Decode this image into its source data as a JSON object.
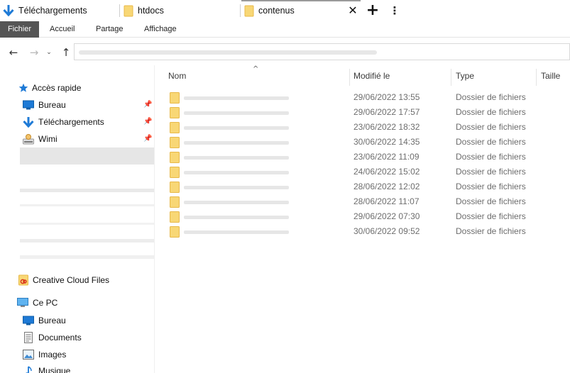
{
  "tabs": [
    {
      "label": "Téléchargements",
      "icon": "download-arrow-icon"
    },
    {
      "label": "htdocs",
      "icon": "folder-icon"
    },
    {
      "label": "contenus",
      "icon": "folder-icon",
      "active": true
    }
  ],
  "tab_controls": {
    "close": "✕",
    "add": "+",
    "menu": "⋮"
  },
  "ribbon": {
    "file_label": "Fichier",
    "tabs": [
      "Accueil",
      "Partage",
      "Affichage"
    ]
  },
  "nav": {
    "back": "←",
    "forward": "→",
    "dropdown": "⌄",
    "up": "↑"
  },
  "sidebar": {
    "quick_access": "Accès rapide",
    "pinned": [
      {
        "label": "Bureau",
        "icon": "desktop-icon"
      },
      {
        "label": "Téléchargements",
        "icon": "download-arrow-icon"
      },
      {
        "label": "Wimi",
        "icon": "user-icon"
      }
    ],
    "creative_cloud": "Creative Cloud Files",
    "this_pc": "Ce PC",
    "pc_items": [
      {
        "label": "Bureau",
        "icon": "desktop-icon"
      },
      {
        "label": "Documents",
        "icon": "document-icon"
      },
      {
        "label": "Images",
        "icon": "image-icon"
      },
      {
        "label": "Musique",
        "icon": "music-icon"
      }
    ]
  },
  "columns": {
    "name": "Nom",
    "modified": "Modifié le",
    "type": "Type",
    "size": "Taille"
  },
  "files": [
    {
      "modified": "29/06/2022 13:55",
      "type": "Dossier de fichiers"
    },
    {
      "modified": "29/06/2022 17:57",
      "type": "Dossier de fichiers"
    },
    {
      "modified": "23/06/2022 18:32",
      "type": "Dossier de fichiers"
    },
    {
      "modified": "30/06/2022 14:35",
      "type": "Dossier de fichiers"
    },
    {
      "modified": "23/06/2022 11:09",
      "type": "Dossier de fichiers"
    },
    {
      "modified": "24/06/2022 15:02",
      "type": "Dossier de fichiers"
    },
    {
      "modified": "28/06/2022 12:02",
      "type": "Dossier de fichiers"
    },
    {
      "modified": "28/06/2022 11:07",
      "type": "Dossier de fichiers"
    },
    {
      "modified": "29/06/2022 07:30",
      "type": "Dossier de fichiers"
    },
    {
      "modified": "30/06/2022 09:52",
      "type": "Dossier de fichiers"
    }
  ],
  "colors": {
    "folder": "#f8d775",
    "folder_dark": "#e8b94a",
    "accent_blue": "#1e7ad6",
    "file_tab_bg": "#555555"
  }
}
